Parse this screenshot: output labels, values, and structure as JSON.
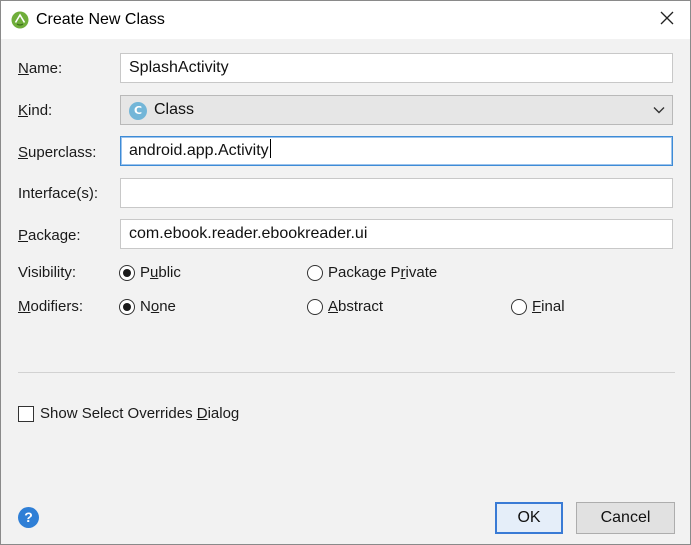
{
  "window": {
    "title": "Create New Class",
    "icon": "android-studio-icon",
    "close_icon": "close-icon"
  },
  "form": {
    "name": {
      "label_u": "N",
      "label_rest": "ame:",
      "value": "SplashActivity"
    },
    "kind": {
      "label_u": "K",
      "label_rest": "ind:",
      "icon_letter": "C",
      "value": "Class",
      "icon_color": "#73b6d8"
    },
    "superclass": {
      "label_u": "S",
      "label_rest": "uperclass:",
      "value": "android.app.Activity"
    },
    "interfaces": {
      "label_pre": "Interface(s):",
      "value": ""
    },
    "package": {
      "label_u": "P",
      "label_rest": "ackage:",
      "value": "com.ebook.reader.ebookreader.ui"
    },
    "visibility": {
      "label": "Visibility:",
      "options": [
        {
          "pre": "P",
          "u": "u",
          "post": "blic",
          "selected": true
        },
        {
          "pre": "Package P",
          "u": "r",
          "post": "ivate",
          "selected": false
        }
      ]
    },
    "modifiers": {
      "label_u": "M",
      "label_rest": "odifiers:",
      "options": [
        {
          "pre": "N",
          "u": "o",
          "post": "ne",
          "selected": true
        },
        {
          "pre": "",
          "u": "A",
          "post": "bstract",
          "selected": false
        },
        {
          "pre": "",
          "u": "F",
          "post": "inal",
          "selected": false
        }
      ]
    }
  },
  "overrides_checkbox": {
    "pre": "Show Select Overrides ",
    "u": "D",
    "post": "ialog",
    "checked": false
  },
  "buttons": {
    "help": "?",
    "ok": "OK",
    "cancel": "Cancel"
  },
  "colors": {
    "accent": "#3a7bd5",
    "help": "#2f7fd6",
    "android_green": "#6fae3a"
  }
}
